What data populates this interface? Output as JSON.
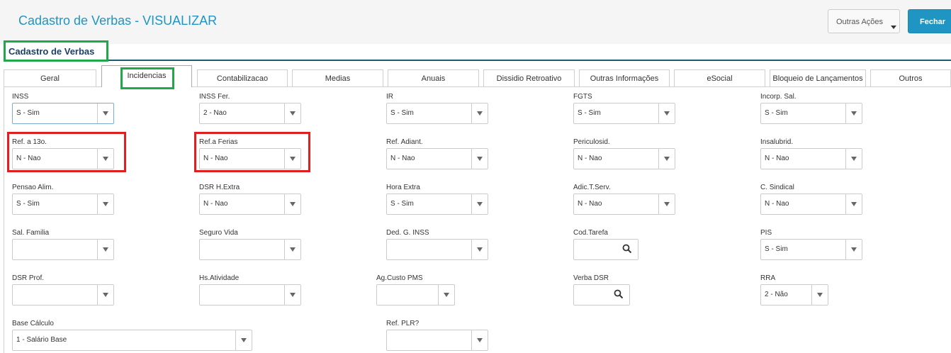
{
  "header": {
    "title": "Cadastro de Verbas - VISUALIZAR",
    "outras_acoes_label": "Outras Ações",
    "fechar_label": "Fechar"
  },
  "section_title": "Cadastro de Verbas",
  "tabs": [
    {
      "label": "Geral",
      "active": false
    },
    {
      "label": "Incidencias",
      "active": true
    },
    {
      "label": "Contabilizacao",
      "active": false
    },
    {
      "label": "Medias",
      "active": false
    },
    {
      "label": "Anuais",
      "active": false
    },
    {
      "label": "Dissidio Retroativo",
      "active": false
    },
    {
      "label": "Outras Informações",
      "active": false
    },
    {
      "label": "eSocial",
      "active": false
    },
    {
      "label": "Bloqueio de Lançamentos",
      "active": false
    },
    {
      "label": "Outros",
      "active": false
    }
  ],
  "fields": {
    "inss": {
      "label": "INSS",
      "value": "S - Sim"
    },
    "inss_fer": {
      "label": "INSS Fer.",
      "value": "2 - Nao"
    },
    "ir": {
      "label": "IR",
      "value": "S - Sim"
    },
    "fgts": {
      "label": "FGTS",
      "value": "S - Sim"
    },
    "incorp_sal": {
      "label": "Incorp. Sal.",
      "value": "S - Sim"
    },
    "ref_13o": {
      "label": "Ref. a 13o.",
      "value": "N - Nao"
    },
    "ref_ferias": {
      "label": "Ref.a Ferias",
      "value": "N - Nao"
    },
    "ref_adiant": {
      "label": "Ref. Adiant.",
      "value": "N - Nao"
    },
    "periculosid": {
      "label": "Periculosid.",
      "value": "N - Nao"
    },
    "insalubrid": {
      "label": "Insalubrid.",
      "value": "N - Nao"
    },
    "pensao_alim": {
      "label": "Pensao Alim.",
      "value": "S - Sim"
    },
    "dsr_hextra": {
      "label": "DSR H.Extra",
      "value": "N - Nao"
    },
    "hora_extra": {
      "label": "Hora Extra",
      "value": "S - Sim"
    },
    "adic_tserv": {
      "label": "Adic.T.Serv.",
      "value": "N - Nao"
    },
    "c_sindical": {
      "label": "C. Sindical",
      "value": "N - Nao"
    },
    "sal_familia": {
      "label": "Sal. Familia",
      "value": ""
    },
    "seguro_vida": {
      "label": "Seguro Vida",
      "value": ""
    },
    "ded_g_inss": {
      "label": "Ded. G. INSS",
      "value": ""
    },
    "cod_tarefa": {
      "label": "Cod.Tarefa",
      "value": ""
    },
    "pis": {
      "label": "PIS",
      "value": "S - Sim"
    },
    "dsr_prof": {
      "label": "DSR Prof.",
      "value": ""
    },
    "hs_atividade": {
      "label": "Hs.Atividade",
      "value": ""
    },
    "ag_custo_pms": {
      "label": "Ag.Custo PMS",
      "value": ""
    },
    "verba_dsr": {
      "label": "Verba DSR",
      "value": ""
    },
    "rra": {
      "label": "RRA",
      "value": "2 - Não"
    },
    "base_calculo": {
      "label": "Base Cálculo",
      "value": "1 - Salário Base"
    },
    "ref_plr": {
      "label": "Ref. PLR?",
      "value": ""
    }
  },
  "icons": {
    "dropdown": "chevron-down-icon",
    "lookup": "search-icon"
  },
  "colors": {
    "title_blue": "#1f95c4",
    "section_navy": "#1b3f66",
    "highlight_green": "#22a84a",
    "highlight_red": "#e02020"
  }
}
